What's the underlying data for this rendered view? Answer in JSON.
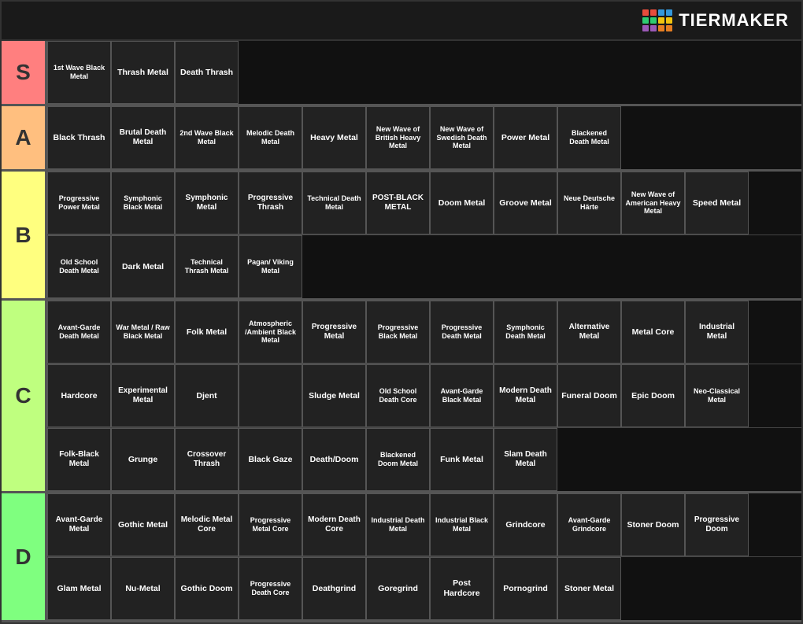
{
  "logo": {
    "text": "TiERMAKER",
    "dots": [
      {
        "color": "#e74c3c"
      },
      {
        "color": "#e74c3c"
      },
      {
        "color": "#3498db"
      },
      {
        "color": "#3498db"
      },
      {
        "color": "#2ecc71"
      },
      {
        "color": "#2ecc71"
      },
      {
        "color": "#f1c40f"
      },
      {
        "color": "#f1c40f"
      },
      {
        "color": "#9b59b6"
      },
      {
        "color": "#9b59b6"
      },
      {
        "color": "#e67e22"
      },
      {
        "color": "#e67e22"
      }
    ]
  },
  "tiers": [
    {
      "label": "S",
      "color": "#ff7f7f",
      "rows": [
        [
          "1st Wave Black Metal",
          "Thrash Metal",
          "Death Thrash"
        ]
      ]
    },
    {
      "label": "A",
      "color": "#ffbf7f",
      "rows": [
        [
          "Black Thrash",
          "Brutal Death Metal",
          "2nd Wave Black Metal",
          "Melodic Death Metal",
          "Heavy Metal",
          "New Wave of British Heavy Metal",
          "New Wave of Swedish Death Metal",
          "Power Metal",
          "Blackened Death Metal"
        ]
      ]
    },
    {
      "label": "B",
      "color": "#ffff7f",
      "rows": [
        [
          "Progressive Power Metal",
          "Symphonic Black Metal",
          "Symphonic Metal",
          "Progressive Thrash",
          "Technical Death Metal",
          "POST-BLACK METAL",
          "Doom Metal",
          "Groove Metal",
          "Neue Deutsche Härte",
          "New Wave of American Heavy Metal",
          "Speed Metal"
        ],
        [
          "Old School Death Metal",
          "Dark Metal",
          "Technical Thrash Metal",
          "Pagan/ Viking Metal"
        ]
      ]
    },
    {
      "label": "C",
      "color": "#bfff7f",
      "rows": [
        [
          "Avant-Garde Death Metal",
          "War Metal / Raw Black Metal",
          "Folk Metal",
          "Atmospheric /Ambient Black Metal",
          "Progressive Metal",
          "Progressive Black Metal",
          "Progressive Death Metal",
          "Symphonic Death Metal",
          "Alternative Metal",
          "Metal Core",
          "Industrial Metal"
        ],
        [
          "Hardcore",
          "Experimental Metal",
          "Djent",
          "",
          "Sludge Metal",
          "Old School Death Core",
          "Avant-Garde Black Metal",
          "Modern Death Metal",
          "Funeral Doom",
          "Epic Doom",
          "Neo-Classical Metal"
        ],
        [
          "Folk-Black Metal",
          "Grunge",
          "Crossover Thrash",
          "Black Gaze",
          "Death/Doom",
          "Blackened Doom Metal",
          "Funk Metal",
          "Slam Death Metal"
        ]
      ]
    },
    {
      "label": "D",
      "color": "#7fff7f",
      "rows": [
        [
          "Avant-Garde Metal",
          "Gothic Metal",
          "Melodic Metal Core",
          "Progressive Metal Core",
          "Modern Death Core",
          "Industrial Death Metal",
          "Industrial Black Metal",
          "Grindcore",
          "Avant-Garde Grindcore",
          "Stoner Doom",
          "Progressive Doom"
        ],
        [
          "Glam Metal",
          "Nu-Metal",
          "Gothic Doom",
          "Progressive Death Core",
          "Deathgrind",
          "Goregrind",
          "Post Hardcore",
          "Pornogrind",
          "Stoner Metal"
        ]
      ]
    }
  ]
}
